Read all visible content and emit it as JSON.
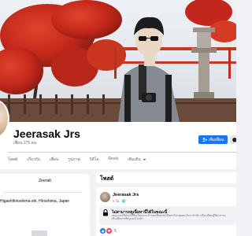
{
  "profile": {
    "name": "Jeerasak Jrs",
    "friends": "เพื่อน 275 คน"
  },
  "actions": {
    "add_friend": "เพิ่มเพื่อน"
  },
  "tabs": [
    "โพสต์",
    "เกี่ยวกับ",
    "เพื่อน",
    "รูปภาพ",
    "วิดีโอ",
    "Reels",
    "เพิ่มเติม"
  ],
  "intro": {
    "bio": "Zeeratt",
    "location": "Higashihiroshima-shi, Hiroshima, Japan"
  },
  "posts": {
    "title": "โพสต์",
    "items": [
      {
        "author": "Jeerasak Jrs",
        "meta": "5 วัน · 🌐",
        "content_title": "ไม่สามารถดูเนื้อหานี้ได้ในขณะนี้",
        "content_body_1": "เหตุการณ์นี้มักเกิดขึ้นเนื่องจากเจ้าของเพียงแชร์เนื้อหากับกลุ่มคนเล็กๆ เท่านั้น หรือเปลี่ยนผู้ที่สามารถ",
        "content_body_2": "เห็นเนื้อหาหรือถูกลบไปแล้ว",
        "reaction_count": "5"
      }
    ]
  },
  "colors": {
    "brand_blue": "#1877f2",
    "background": "#f0f2f5",
    "card": "#ffffff",
    "text_primary": "#050505",
    "text_secondary": "#65676b"
  },
  "icons": {
    "add_friend": "person-add-icon",
    "messenger": "messenger-icon",
    "more_chevron": "chevron-down-icon",
    "privacy": "globe-icon",
    "locked": "lock-icon",
    "reactions": [
      "like-reaction-icon",
      "love-reaction-icon"
    ]
  }
}
